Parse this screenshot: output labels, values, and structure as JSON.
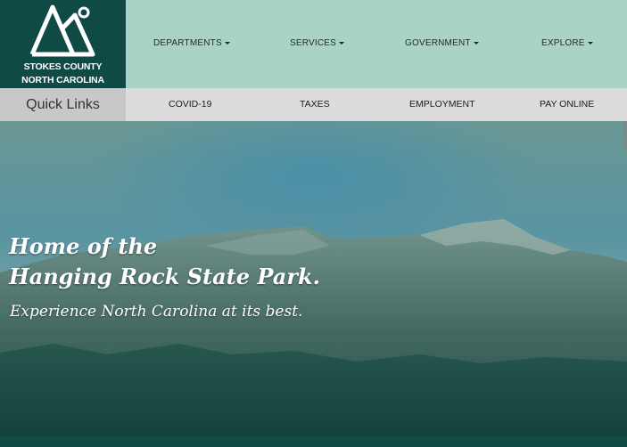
{
  "logo": {
    "line1": "STOKES COUNTY",
    "line2": "NORTH CAROLINA",
    "icon": "mountain-sun-icon"
  },
  "nav": {
    "items": [
      {
        "label": "DEPARTMENTS"
      },
      {
        "label": "SERVICES"
      },
      {
        "label": "GOVERNMENT"
      },
      {
        "label": "EXPLORE"
      }
    ]
  },
  "quick_links": {
    "title": "Quick Links",
    "items": [
      {
        "label": "COVID-19"
      },
      {
        "label": "TAXES"
      },
      {
        "label": "EMPLOYMENT"
      },
      {
        "label": "PAY ONLINE"
      }
    ]
  },
  "hero": {
    "line1": "Home of the",
    "line2": "Hanging Rock State Park.",
    "tagline": "Experience North Carolina at its best."
  },
  "colors": {
    "brand_dark": "#0f4a44",
    "header_mint": "#a9d3c6",
    "quick_bar": "#dcdcdc"
  }
}
